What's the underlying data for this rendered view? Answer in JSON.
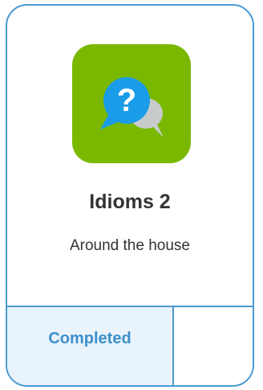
{
  "card": {
    "title": "Idioms 2",
    "subtitle": "Around the house",
    "icon": "question-chat-bubbles-icon",
    "status": "Completed"
  },
  "colors": {
    "border": "#4a9ad3",
    "icon_background": "#7ab800",
    "bubble_front": "#1a9ce8",
    "bubble_back": "#c8cbcc",
    "status_background": "#e9f3fb",
    "status_text": "#3d8fcb",
    "text": "#333333"
  }
}
